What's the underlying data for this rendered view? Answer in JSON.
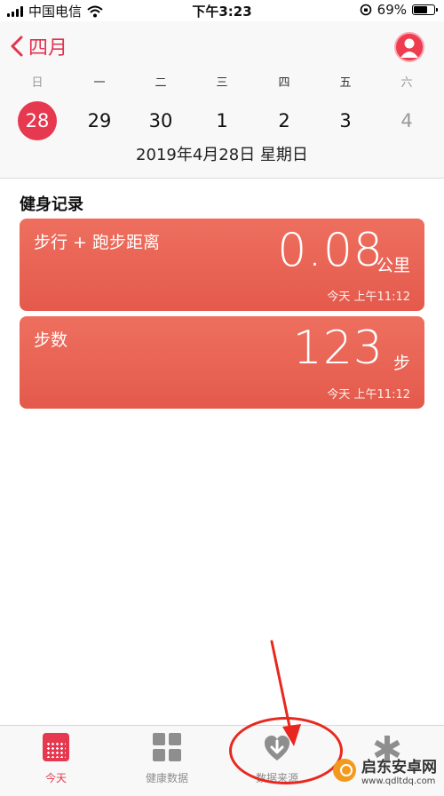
{
  "status_bar": {
    "carrier": "中国电信",
    "time": "下午3:23",
    "battery_percent": "69%"
  },
  "header": {
    "back_label": "四月",
    "weekdays": [
      "日",
      "一",
      "二",
      "三",
      "四",
      "五",
      "六"
    ],
    "dates": [
      "28",
      "29",
      "30",
      "1",
      "2",
      "3",
      "4"
    ],
    "selected_date": "28",
    "full_date": "2019年4月28日 星期日"
  },
  "section_title": "健身记录",
  "cards": [
    {
      "title": "步行 + 跑步距离",
      "value": "0.08",
      "unit": "公里",
      "time": "今天 上午11:12"
    },
    {
      "title": "步数",
      "value": "123",
      "unit": "步",
      "time": "今天 上午11:12"
    }
  ],
  "tabs": [
    {
      "label": "今天",
      "icon": "calendar-icon",
      "active": true
    },
    {
      "label": "健康数据",
      "icon": "grid-icon",
      "active": false
    },
    {
      "label": "数据来源",
      "icon": "heart-download-icon",
      "active": false
    },
    {
      "label": "",
      "icon": "medical-id-icon",
      "active": false
    }
  ],
  "watermark": {
    "name": "启东安卓网",
    "url": "www.qdltdq.com"
  },
  "colors": {
    "accent": "#e6384f",
    "card": "#e8604f",
    "annotation": "#e8281e"
  }
}
